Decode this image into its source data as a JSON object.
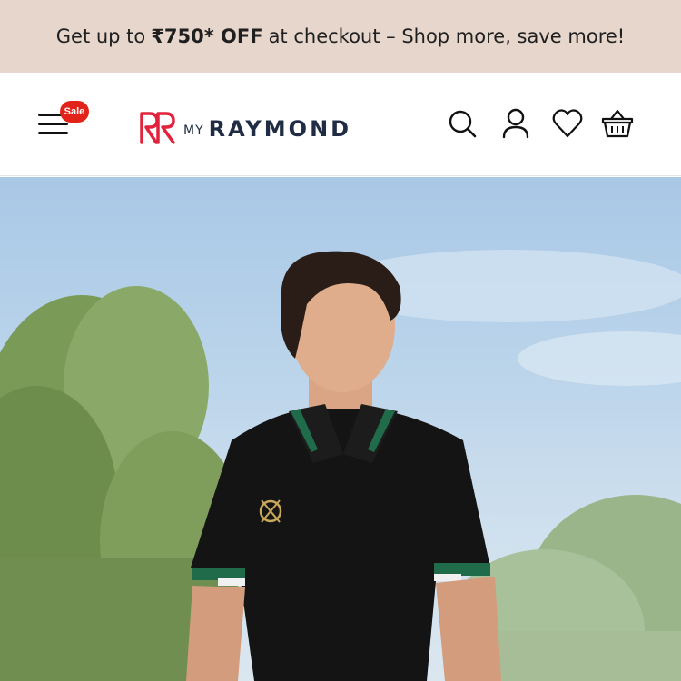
{
  "promo": {
    "text_before": "Get up to",
    "highlight": "₹750* OFF",
    "text_after": "at checkout – Shop more, save more!"
  },
  "header": {
    "sale_badge": "Sale",
    "logo_my": "MY",
    "logo_name": "RAYMOND",
    "icons": [
      "menu-icon",
      "search-icon",
      "account-icon",
      "wishlist-heart-icon",
      "basket-icon"
    ]
  },
  "hero": {
    "image": "man-in-black-polo-outdoors"
  },
  "colors": {
    "promo_bg": "#e6d6cc",
    "sale_badge": "#e2231a",
    "logo_mark": "#e2233d",
    "logo_text": "#1f2c44"
  }
}
